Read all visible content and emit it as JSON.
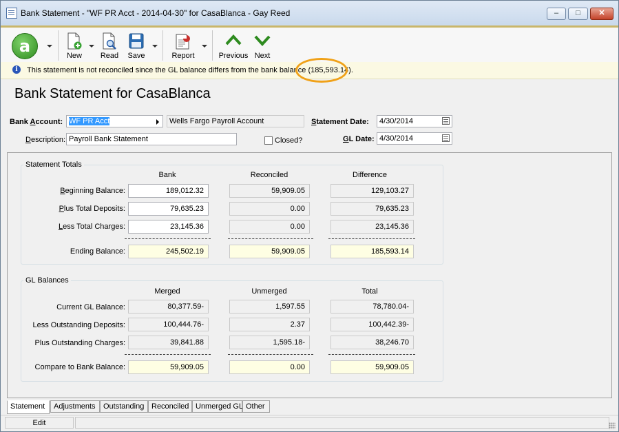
{
  "window": {
    "title": "Bank Statement - \"WF PR Acct - 2014-04-30\" for CasaBlanca - Gay Reed",
    "minimize": "–",
    "maximize": "□",
    "close": "✕"
  },
  "toolbar": {
    "logo_letter": "a",
    "new_label": "New",
    "read_label": "Read",
    "save_label": "Save",
    "report_label": "Report",
    "previous_label": "Previous",
    "next_label": "Next",
    "accent_color": "#c9b66a",
    "arrow_color": "#2e8b1f"
  },
  "info_bar": {
    "message": "This statement is not reconciled since the GL balance differs from the bank balance",
    "amount": "(185,593.14)."
  },
  "page_title": "Bank Statement for CasaBlanca",
  "form": {
    "bank_account_label_pre": "Bank ",
    "bank_account_label_u": "A",
    "bank_account_label_post": "ccount:",
    "bank_account_value": "WF PR Acct",
    "bank_account_name": "Wells Fargo Payroll Account",
    "description_label_pre": "",
    "description_label_u": "D",
    "description_label_post": "escription:",
    "description_value": "Payroll Bank Statement",
    "closed_label": "Closed?",
    "statement_date_label_u": "S",
    "statement_date_label_post": "tatement Date:",
    "statement_date_value": "4/30/2014",
    "gl_date_label_u": "G",
    "gl_date_label_post": "L Date:",
    "gl_date_value": "4/30/2014"
  },
  "statement_totals": {
    "title": "Statement Totals",
    "columns": [
      "Bank",
      "Reconciled",
      "Difference"
    ],
    "rows": [
      {
        "label_u": "B",
        "label_rest": "eginning Balance:",
        "values": [
          "189,012.32",
          "59,909.05",
          "129,103.27"
        ]
      },
      {
        "label_u": "P",
        "label_rest": "lus Total Deposits:",
        "values": [
          "79,635.23",
          "0.00",
          "79,635.23"
        ]
      },
      {
        "label_u": "L",
        "label_rest": "ess Total Charges:",
        "values": [
          "23,145.36",
          "0.00",
          "23,145.36"
        ]
      }
    ],
    "ending": {
      "label": "Ending Balance:",
      "values": [
        "245,502.19",
        "59,909.05",
        "185,593.14"
      ]
    }
  },
  "gl_balances": {
    "title": "GL Balances",
    "columns": [
      "Merged",
      "Unmerged",
      "Total"
    ],
    "rows": [
      {
        "label": "Current GL Balance:",
        "values": [
          "80,377.59-",
          "1,597.55",
          "78,780.04-"
        ]
      },
      {
        "label": "Less Outstanding Deposits:",
        "values": [
          "100,444.76-",
          "2.37",
          "100,442.39-"
        ]
      },
      {
        "label": "Plus Outstanding Charges:",
        "values": [
          "39,841.88",
          "1,595.18-",
          "38,246.70"
        ]
      }
    ],
    "compare": {
      "label": "Compare to Bank Balance:",
      "values": [
        "59,909.05",
        "0.00",
        "59,909.05"
      ]
    }
  },
  "tabs": [
    "Statement",
    "Adjustments",
    "Outstanding",
    "Reconciled",
    "Unmerged GL",
    "Other"
  ],
  "status": {
    "mode": "Edit"
  }
}
